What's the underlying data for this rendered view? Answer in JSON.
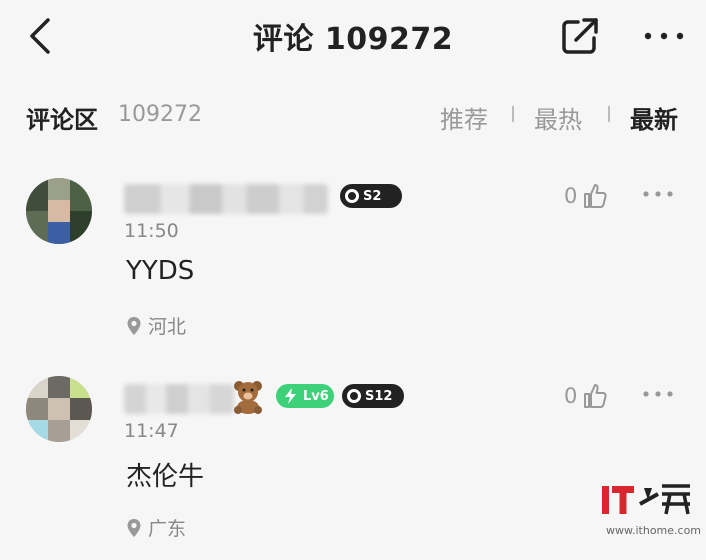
{
  "header": {
    "title": "评论 109272",
    "back_icon": "chevron-left-icon",
    "share_icon": "share-icon",
    "more_icon": "more-dots-icon"
  },
  "section": {
    "title": "评论区",
    "count": "109272",
    "sort_options": [
      "推荐",
      "最热",
      "最新"
    ],
    "active_sort": "最新"
  },
  "comments": [
    {
      "time": "11:50",
      "text": "YYDS",
      "location": "河北",
      "likes": "0",
      "badges": [
        {
          "type": "season",
          "label": "S2"
        }
      ]
    },
    {
      "time": "11:47",
      "text": "杰伦牛",
      "location": "广东",
      "likes": "0",
      "badges": [
        {
          "type": "teddy"
        },
        {
          "type": "level",
          "label": "Lv6"
        },
        {
          "type": "season",
          "label": "S12"
        }
      ]
    }
  ],
  "watermark": {
    "url": "www.ithome.com"
  },
  "colors": {
    "background": "#f6f6f6",
    "text_primary": "#222222",
    "text_secondary": "#888888",
    "level_badge": "#3fd07a",
    "watermark_red": "#d8262f"
  }
}
